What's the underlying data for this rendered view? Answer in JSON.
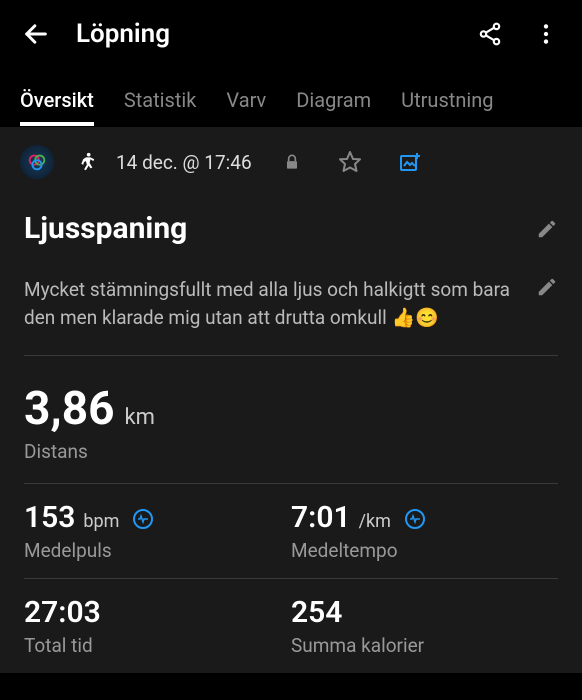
{
  "header": {
    "title": "Löpning"
  },
  "tabs": [
    {
      "label": "Översikt",
      "active": true
    },
    {
      "label": "Statistik",
      "active": false
    },
    {
      "label": "Varv",
      "active": false
    },
    {
      "label": "Diagram",
      "active": false
    },
    {
      "label": "Utrustning",
      "active": false
    }
  ],
  "activity": {
    "datetime": "14 dec. @ 17:46",
    "title": "Ljusspaning",
    "description": "Mycket stämningsfullt med alla ljus och halkigtt som bara den men klarade mig utan att drutta omkull 👍😊"
  },
  "stats": {
    "distance": {
      "value": "3,86",
      "unit": "km",
      "label": "Distans"
    },
    "avg_hr": {
      "value": "153",
      "unit": "bpm",
      "label": "Medelpuls"
    },
    "avg_pace": {
      "value": "7:01",
      "unit": "/km",
      "label": "Medeltempo"
    },
    "total_time": {
      "value": "27:03",
      "label": "Total tid"
    },
    "calories": {
      "value": "254",
      "label": "Summa kalorier"
    }
  }
}
